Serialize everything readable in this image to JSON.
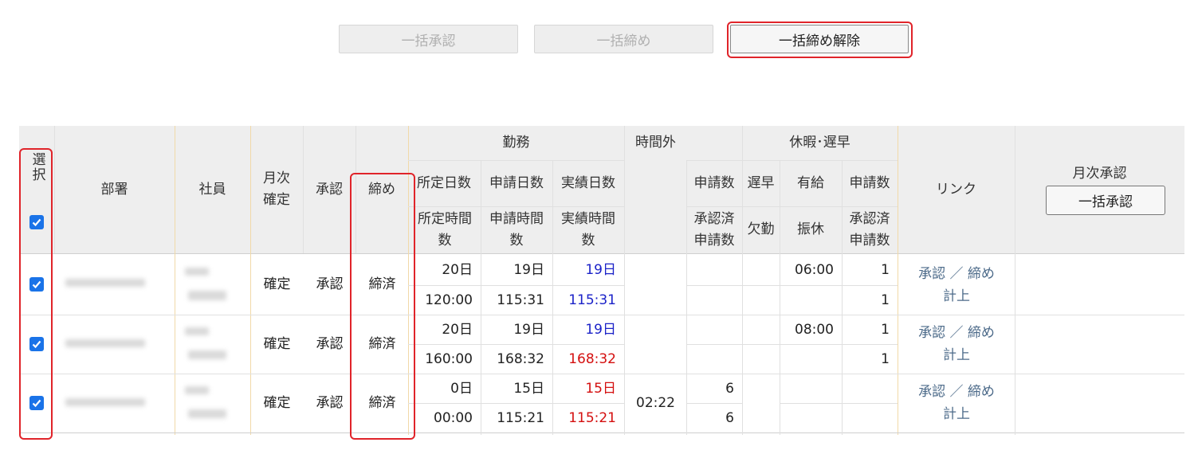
{
  "toolbar": {
    "bulk_approve": "一括承認",
    "bulk_close": "一括締め",
    "bulk_close_release": "一括締め解除"
  },
  "headers": {
    "select": "選択",
    "department": "部署",
    "employee": "社員",
    "monthly_confirm": "月次確定",
    "approval": "承認",
    "closing": "締め",
    "work": "勤務",
    "scheduled_days": "所定日数",
    "applied_days": "申請日数",
    "actual_days": "実績日数",
    "scheduled_hours": "所定時間数",
    "applied_hours": "申請時間数",
    "actual_hours": "実績時間数",
    "overtime": "時間外",
    "ot_applications": "申請数",
    "ot_approved_applications": "承認済申請数",
    "leave_late": "休暇･遅早",
    "late": "遅早",
    "absence": "欠勤",
    "paid_leave": "有給",
    "substitute_holiday": "振休",
    "lv_applications": "申請数",
    "lv_approved_applications": "承認済申請数",
    "link": "リンク",
    "monthly_approval": "月次承認",
    "monthly_bulk_approve": "一括承認"
  },
  "rows": [
    {
      "confirm": "確定",
      "approval": "承認",
      "closing": "締済",
      "sched_days": "20日",
      "applied_days": "19日",
      "actual_days": "19日",
      "sched_hours": "120:00",
      "applied_hours": "115:31",
      "actual_hours": "115:31",
      "overtime": "",
      "ot_app": "",
      "ot_approved": "",
      "late": "",
      "absence": "",
      "paid": "06:00",
      "subst": "",
      "lv_app": "1",
      "lv_approved": "1",
      "link_approve": "承認",
      "link_sep": "／",
      "link_close": "締め",
      "link_post": "計上"
    },
    {
      "confirm": "確定",
      "approval": "承認",
      "closing": "締済",
      "sched_days": "20日",
      "applied_days": "19日",
      "actual_days": "19日",
      "sched_hours": "160:00",
      "applied_hours": "168:32",
      "actual_hours": "168:32",
      "overtime": "",
      "ot_app": "",
      "ot_approved": "",
      "late": "",
      "absence": "",
      "paid": "08:00",
      "subst": "",
      "lv_app": "1",
      "lv_approved": "1",
      "link_approve": "承認",
      "link_sep": "／",
      "link_close": "締め",
      "link_post": "計上"
    },
    {
      "confirm": "確定",
      "approval": "承認",
      "closing": "締済",
      "sched_days": "0日",
      "applied_days": "15日",
      "actual_days": "15日",
      "sched_hours": "00:00",
      "applied_hours": "115:21",
      "actual_hours": "115:21",
      "overtime": "02:22",
      "ot_app": "6",
      "ot_approved": "6",
      "late": "",
      "absence": "",
      "paid": "",
      "subst": "",
      "lv_app": "",
      "lv_approved": "",
      "link_approve": "承認",
      "link_sep": "／",
      "link_close": "締め",
      "link_post": "計上"
    }
  ],
  "colors": {
    "highlight_red": "#e0242a",
    "actual_blue": "#1b22c8",
    "actual_red": "#d40f0f",
    "link": "#4d6b8a",
    "checkbox": "#1a73e8",
    "header_bg": "#eeeeee"
  }
}
